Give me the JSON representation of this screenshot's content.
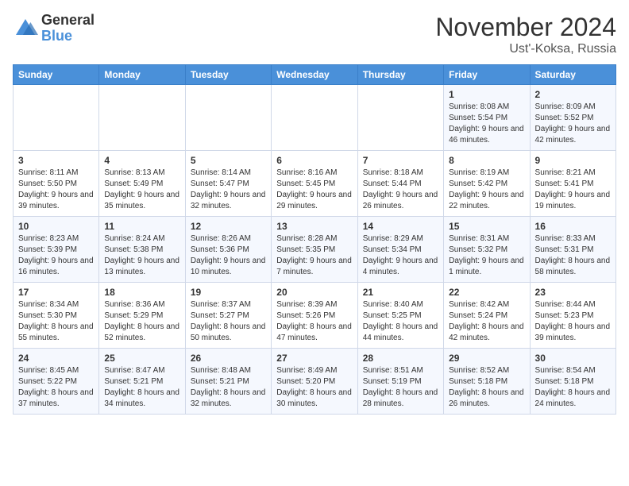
{
  "logo": {
    "general": "General",
    "blue": "Blue"
  },
  "header": {
    "month": "November 2024",
    "location": "Ust'-Koksa, Russia"
  },
  "days_of_week": [
    "Sunday",
    "Monday",
    "Tuesday",
    "Wednesday",
    "Thursday",
    "Friday",
    "Saturday"
  ],
  "weeks": [
    [
      {
        "day": "",
        "content": ""
      },
      {
        "day": "",
        "content": ""
      },
      {
        "day": "",
        "content": ""
      },
      {
        "day": "",
        "content": ""
      },
      {
        "day": "",
        "content": ""
      },
      {
        "day": "1",
        "content": "Sunrise: 8:08 AM\nSunset: 5:54 PM\nDaylight: 9 hours and 46 minutes."
      },
      {
        "day": "2",
        "content": "Sunrise: 8:09 AM\nSunset: 5:52 PM\nDaylight: 9 hours and 42 minutes."
      }
    ],
    [
      {
        "day": "3",
        "content": "Sunrise: 8:11 AM\nSunset: 5:50 PM\nDaylight: 9 hours and 39 minutes."
      },
      {
        "day": "4",
        "content": "Sunrise: 8:13 AM\nSunset: 5:49 PM\nDaylight: 9 hours and 35 minutes."
      },
      {
        "day": "5",
        "content": "Sunrise: 8:14 AM\nSunset: 5:47 PM\nDaylight: 9 hours and 32 minutes."
      },
      {
        "day": "6",
        "content": "Sunrise: 8:16 AM\nSunset: 5:45 PM\nDaylight: 9 hours and 29 minutes."
      },
      {
        "day": "7",
        "content": "Sunrise: 8:18 AM\nSunset: 5:44 PM\nDaylight: 9 hours and 26 minutes."
      },
      {
        "day": "8",
        "content": "Sunrise: 8:19 AM\nSunset: 5:42 PM\nDaylight: 9 hours and 22 minutes."
      },
      {
        "day": "9",
        "content": "Sunrise: 8:21 AM\nSunset: 5:41 PM\nDaylight: 9 hours and 19 minutes."
      }
    ],
    [
      {
        "day": "10",
        "content": "Sunrise: 8:23 AM\nSunset: 5:39 PM\nDaylight: 9 hours and 16 minutes."
      },
      {
        "day": "11",
        "content": "Sunrise: 8:24 AM\nSunset: 5:38 PM\nDaylight: 9 hours and 13 minutes."
      },
      {
        "day": "12",
        "content": "Sunrise: 8:26 AM\nSunset: 5:36 PM\nDaylight: 9 hours and 10 minutes."
      },
      {
        "day": "13",
        "content": "Sunrise: 8:28 AM\nSunset: 5:35 PM\nDaylight: 9 hours and 7 minutes."
      },
      {
        "day": "14",
        "content": "Sunrise: 8:29 AM\nSunset: 5:34 PM\nDaylight: 9 hours and 4 minutes."
      },
      {
        "day": "15",
        "content": "Sunrise: 8:31 AM\nSunset: 5:32 PM\nDaylight: 9 hours and 1 minute."
      },
      {
        "day": "16",
        "content": "Sunrise: 8:33 AM\nSunset: 5:31 PM\nDaylight: 8 hours and 58 minutes."
      }
    ],
    [
      {
        "day": "17",
        "content": "Sunrise: 8:34 AM\nSunset: 5:30 PM\nDaylight: 8 hours and 55 minutes."
      },
      {
        "day": "18",
        "content": "Sunrise: 8:36 AM\nSunset: 5:29 PM\nDaylight: 8 hours and 52 minutes."
      },
      {
        "day": "19",
        "content": "Sunrise: 8:37 AM\nSunset: 5:27 PM\nDaylight: 8 hours and 50 minutes."
      },
      {
        "day": "20",
        "content": "Sunrise: 8:39 AM\nSunset: 5:26 PM\nDaylight: 8 hours and 47 minutes."
      },
      {
        "day": "21",
        "content": "Sunrise: 8:40 AM\nSunset: 5:25 PM\nDaylight: 8 hours and 44 minutes."
      },
      {
        "day": "22",
        "content": "Sunrise: 8:42 AM\nSunset: 5:24 PM\nDaylight: 8 hours and 42 minutes."
      },
      {
        "day": "23",
        "content": "Sunrise: 8:44 AM\nSunset: 5:23 PM\nDaylight: 8 hours and 39 minutes."
      }
    ],
    [
      {
        "day": "24",
        "content": "Sunrise: 8:45 AM\nSunset: 5:22 PM\nDaylight: 8 hours and 37 minutes."
      },
      {
        "day": "25",
        "content": "Sunrise: 8:47 AM\nSunset: 5:21 PM\nDaylight: 8 hours and 34 minutes."
      },
      {
        "day": "26",
        "content": "Sunrise: 8:48 AM\nSunset: 5:21 PM\nDaylight: 8 hours and 32 minutes."
      },
      {
        "day": "27",
        "content": "Sunrise: 8:49 AM\nSunset: 5:20 PM\nDaylight: 8 hours and 30 minutes."
      },
      {
        "day": "28",
        "content": "Sunrise: 8:51 AM\nSunset: 5:19 PM\nDaylight: 8 hours and 28 minutes."
      },
      {
        "day": "29",
        "content": "Sunrise: 8:52 AM\nSunset: 5:18 PM\nDaylight: 8 hours and 26 minutes."
      },
      {
        "day": "30",
        "content": "Sunrise: 8:54 AM\nSunset: 5:18 PM\nDaylight: 8 hours and 24 minutes."
      }
    ]
  ]
}
